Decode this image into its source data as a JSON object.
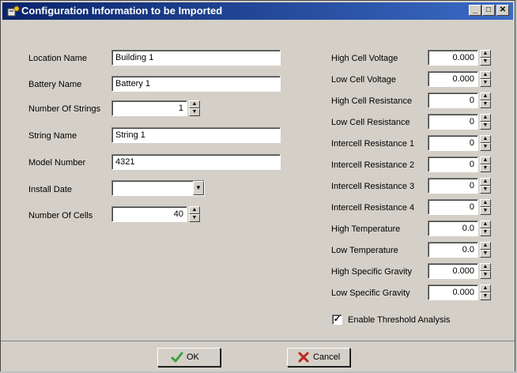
{
  "window": {
    "title": "Configuration Information to be Imported",
    "controls": {
      "minimize": "_",
      "maximize": "□",
      "close": "✕"
    }
  },
  "left_fields": {
    "location_name": {
      "label": "Location Name",
      "value": "Building 1"
    },
    "battery_name": {
      "label": "Battery Name",
      "value": "Battery 1"
    },
    "number_of_strings": {
      "label": "Number Of Strings",
      "value": "1"
    },
    "string_name": {
      "label": "String Name",
      "value": "String 1"
    },
    "model_number": {
      "label": "Model Number",
      "value": "4321"
    },
    "install_date": {
      "label": "Install Date",
      "value": ""
    },
    "number_of_cells": {
      "label": "Number Of Cells",
      "value": "40"
    }
  },
  "right_fields": [
    {
      "label": "High Cell Voltage",
      "value": "0.000"
    },
    {
      "label": "Low Cell Voltage",
      "value": "0.000"
    },
    {
      "label": "High Cell Resistance",
      "value": "0"
    },
    {
      "label": "Low Cell Resistance",
      "value": "0"
    },
    {
      "label": "Intercell Resistance 1",
      "value": "0"
    },
    {
      "label": "Intercell Resistance 2",
      "value": "0"
    },
    {
      "label": "Intercell Resistance 3",
      "value": "0"
    },
    {
      "label": "Intercell Resistance 4",
      "value": "0"
    },
    {
      "label": "High Temperature",
      "value": "0.0"
    },
    {
      "label": "Low Temperature",
      "value": "0.0"
    },
    {
      "label": "High Specific Gravity",
      "value": "0.000"
    },
    {
      "label": "Low Specific Gravity",
      "value": "0.000"
    }
  ],
  "threshold": {
    "label": "Enable Threshold Analysis",
    "checked": true,
    "check_glyph": "✓"
  },
  "buttons": {
    "ok_label": "OK",
    "cancel_label": "Cancel"
  },
  "spinner_glyphs": {
    "up": "▲",
    "down": "▼"
  },
  "icons": {
    "title_icon": "config-app-icon",
    "ok_icon": "checkmark-icon",
    "cancel_icon": "x-mark-icon",
    "dropdown_icon": "chevron-down-icon"
  },
  "colors": {
    "titlebar_start": "#0a246a",
    "titlebar_end": "#3b6bc5",
    "dialog_bg": "#d4d0c8",
    "ok_green": "#3aa13a",
    "cancel_red": "#c0281e"
  }
}
